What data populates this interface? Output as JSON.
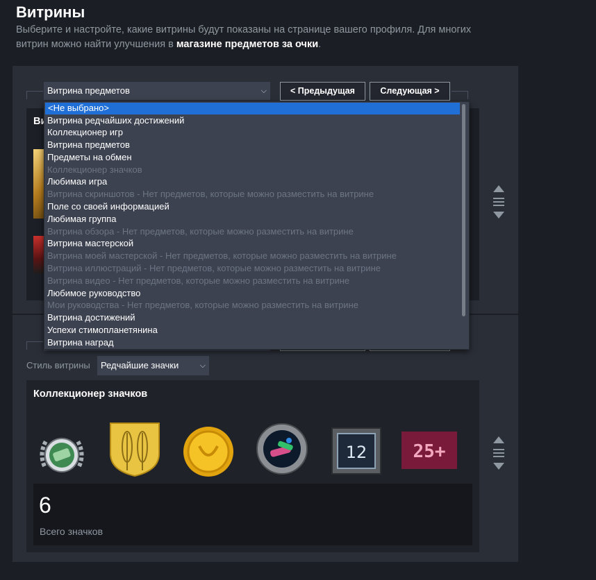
{
  "header": {
    "title": "Витрины",
    "desc_part1": "Выберите и настройте, какие витрины будут показаны на странице вашего профиля. Для многих витрин можно найти улучшения в ",
    "desc_link": "магазине предметов за очки",
    "desc_end": "."
  },
  "showcase1": {
    "selected": "Витрина предметов",
    "prev_label": "< Предыдущая",
    "next_label": "Следующая >",
    "peek_title": "Ви"
  },
  "dropdown": {
    "options": [
      {
        "label": "<Не выбрано>",
        "disabled": false,
        "selected": true
      },
      {
        "label": "Витрина редчайших достижений",
        "disabled": false
      },
      {
        "label": "Коллекционер игр",
        "disabled": false
      },
      {
        "label": "Витрина предметов",
        "disabled": false
      },
      {
        "label": "Предметы на обмен",
        "disabled": false
      },
      {
        "label": "Коллекционер значков",
        "disabled": true
      },
      {
        "label": "Любимая игра",
        "disabled": false
      },
      {
        "label": "Витрина скриншотов - Нет предметов, которые можно разместить на витрине",
        "disabled": true
      },
      {
        "label": "Поле со своей информацией",
        "disabled": false
      },
      {
        "label": "Любимая группа",
        "disabled": false
      },
      {
        "label": "Витрина обзора - Нет предметов, которые можно разместить на витрине",
        "disabled": true
      },
      {
        "label": "Витрина мастерской",
        "disabled": false
      },
      {
        "label": "Витрина моей мастерской - Нет предметов, которые можно разместить на витрине",
        "disabled": true
      },
      {
        "label": "Витрина иллюстраций - Нет предметов, которые можно разместить на витрине",
        "disabled": true
      },
      {
        "label": "Витрина видео - Нет предметов, которые можно разместить на витрине",
        "disabled": true
      },
      {
        "label": "Любимое руководство",
        "disabled": false
      },
      {
        "label": "Мои руководства - Нет предметов, которые можно разместить на витрине",
        "disabled": true
      },
      {
        "label": "Витрина достижений",
        "disabled": false
      },
      {
        "label": "Успехи стимопланетянина",
        "disabled": false
      },
      {
        "label": "Витрина наград",
        "disabled": false
      }
    ]
  },
  "showcase2": {
    "style_label": "Стиль витрины",
    "style_value": "Редчайшие значки",
    "panel_title": "Коллекционер значков",
    "badges": [
      {
        "icon": "laurel-badge-icon"
      },
      {
        "icon": "wheat-shield-badge-icon"
      },
      {
        "icon": "gold-coin-badge-icon"
      },
      {
        "icon": "porthole-badge-icon"
      },
      {
        "icon": "level-12-badge-icon",
        "text": "12"
      },
      {
        "icon": "25-plus-badge-icon",
        "text": "25+"
      }
    ],
    "total_count": "6",
    "total_label": "Всего значков"
  },
  "colors": {
    "background": "#1b1e25",
    "panel": "#2a2e37",
    "select": "#3d4250",
    "highlight": "#1f6fd6"
  }
}
